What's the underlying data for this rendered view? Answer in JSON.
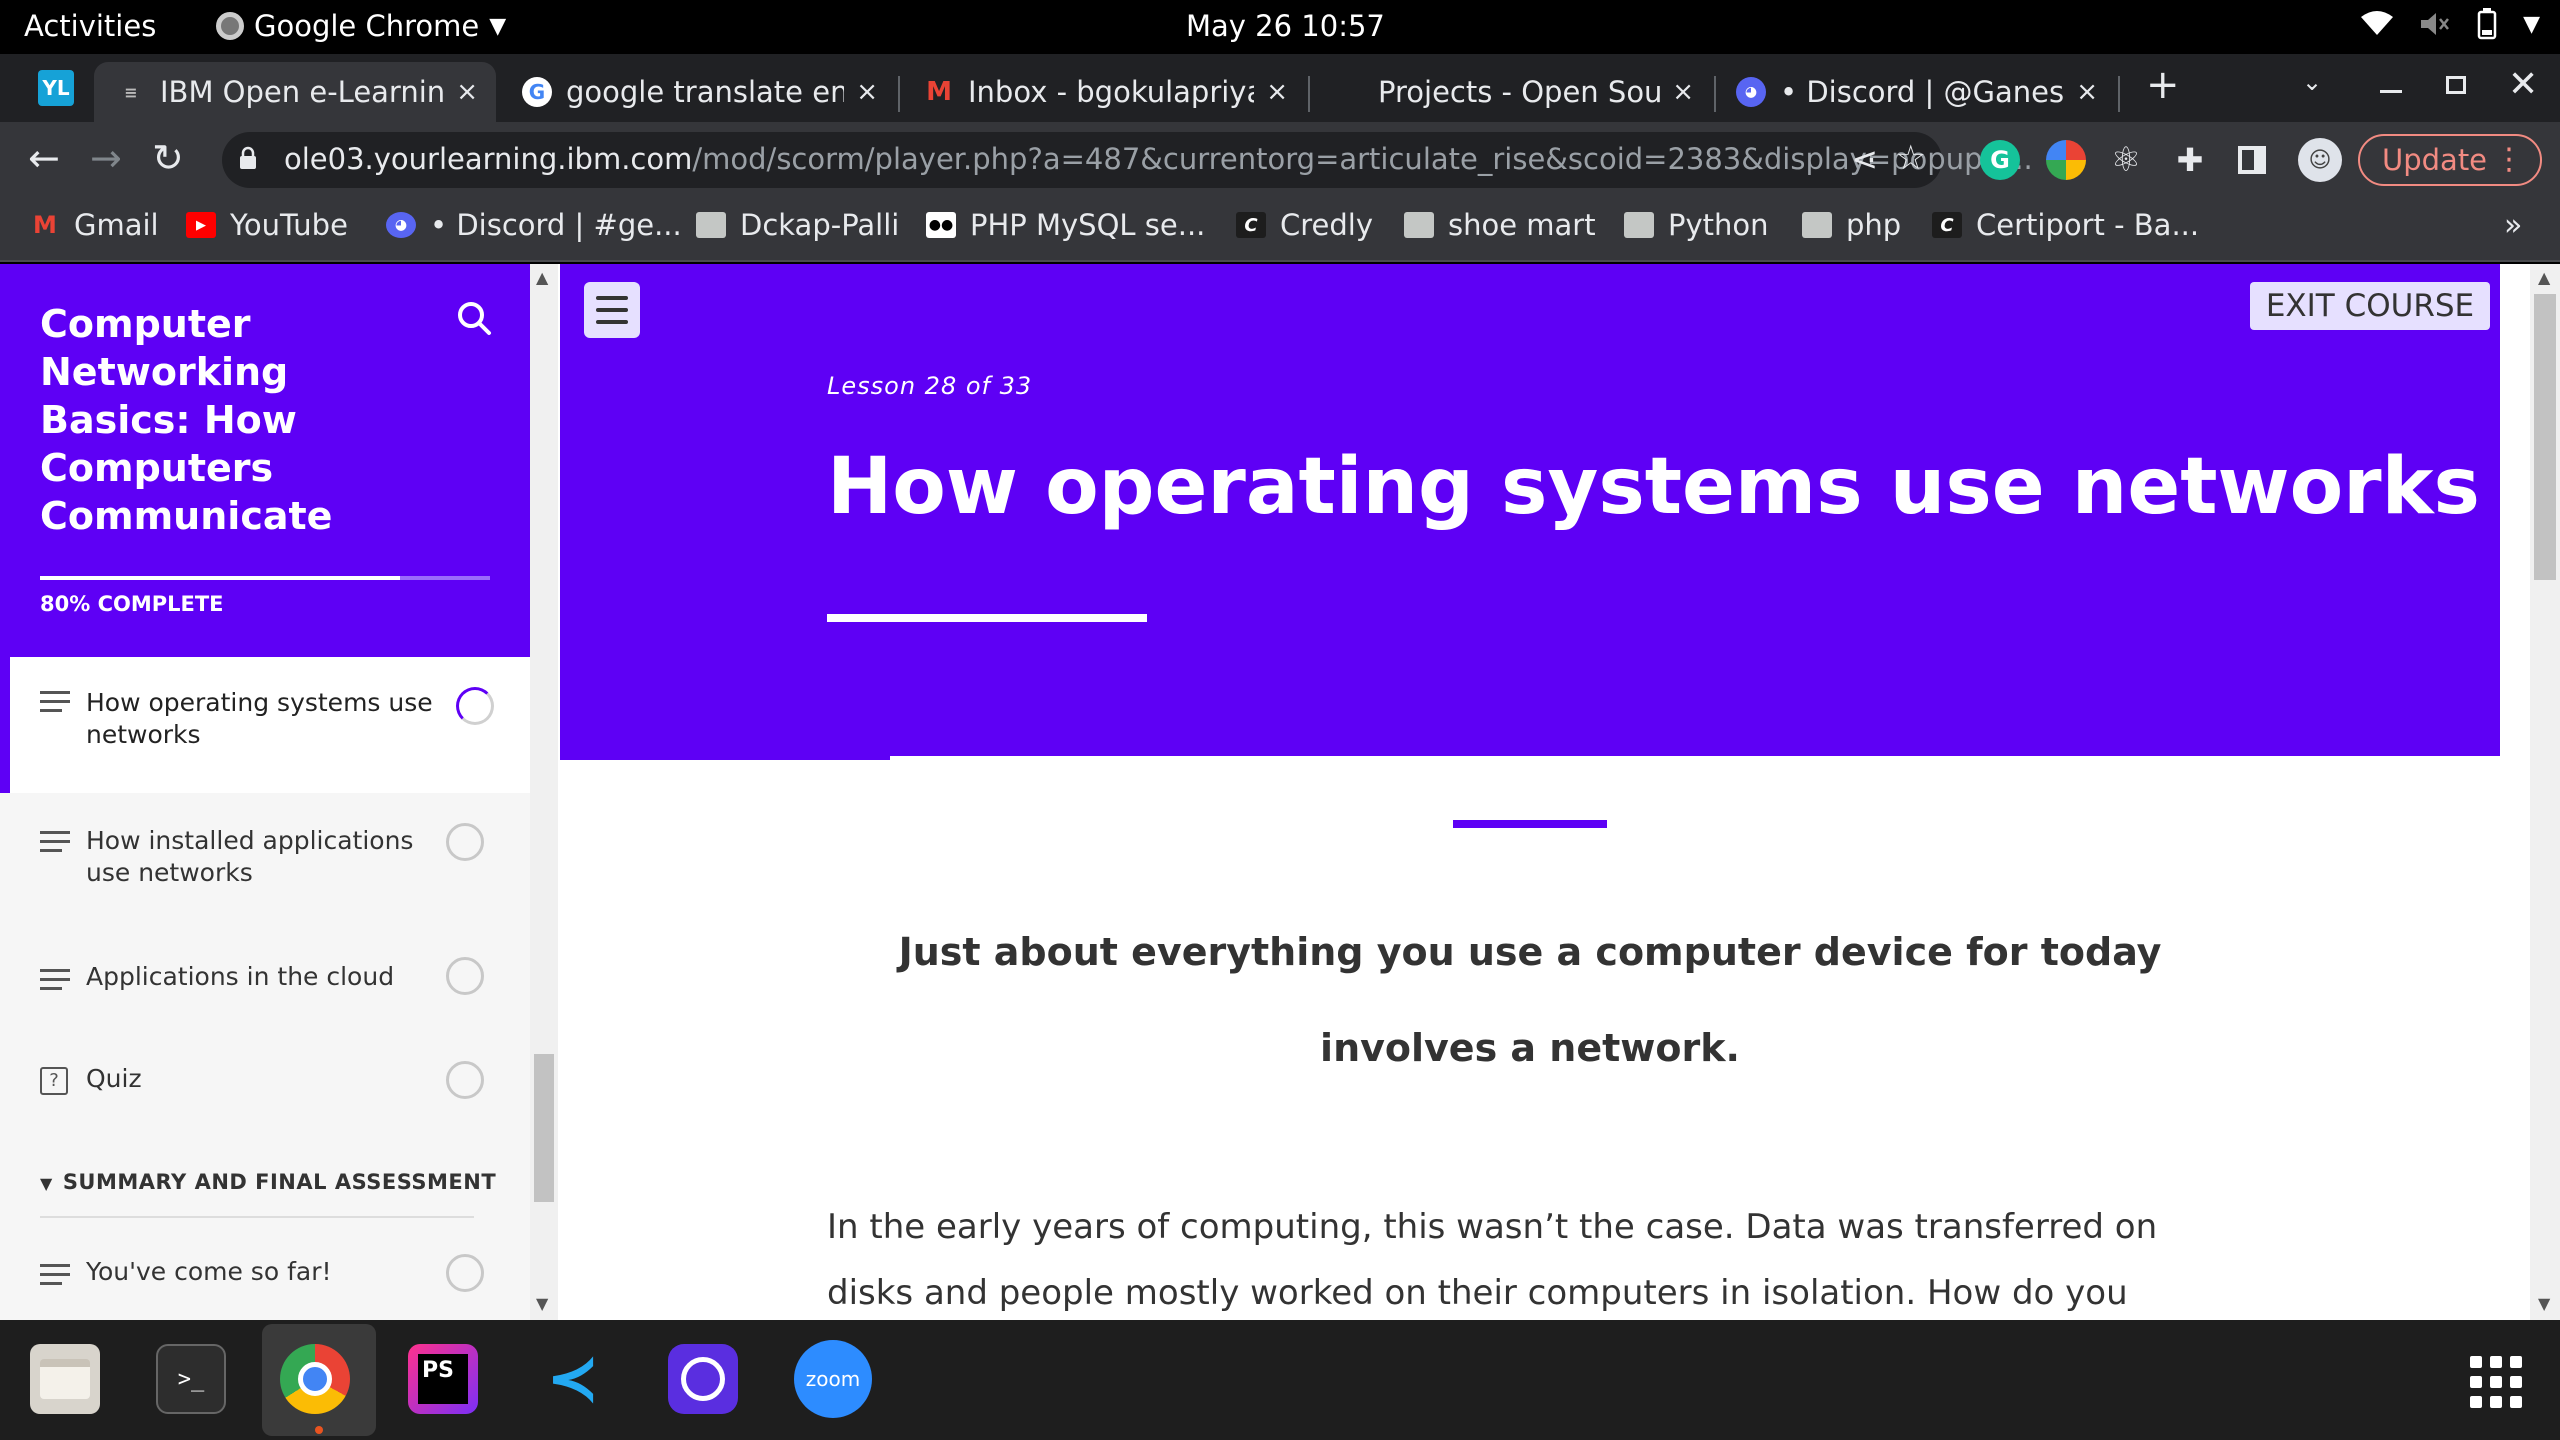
{
  "topbar": {
    "activities": "Activities",
    "app_name": "Google Chrome",
    "clock": "May 26  10:57"
  },
  "tabs": [
    {
      "title": "IBM Open e-Learning",
      "close": "×"
    },
    {
      "title": "google translate eng",
      "close": "×"
    },
    {
      "title": "Inbox - bgokulapriya",
      "close": "×"
    },
    {
      "title": "Projects - Open Sour",
      "close": "×"
    },
    {
      "title": "• Discord | @Ganesh",
      "close": "×"
    }
  ],
  "toolbar": {
    "url_host": "ole03.yourlearning.ibm.com",
    "url_path": "/mod/scorm/player.php?a=487&currentorg=articulate_rise&scoid=2383&display=popup&...",
    "update_label": "Update"
  },
  "bookmarks": [
    {
      "label": "Gmail"
    },
    {
      "label": "YouTube"
    },
    {
      "label": "• Discord | #ge..."
    },
    {
      "label": "Dckap-Palli"
    },
    {
      "label": "PHP MySQL se..."
    },
    {
      "label": "Credly"
    },
    {
      "label": "shoe mart"
    },
    {
      "label": "Python"
    },
    {
      "label": "php"
    },
    {
      "label": "Certiport - Ba..."
    }
  ],
  "sidebar": {
    "course_title": "Computer Networking Basics: How Computers Communicate",
    "progress_label": "80% COMPLETE",
    "progress_fraction": 0.8,
    "lessons": [
      {
        "label": "How operating systems use networks"
      },
      {
        "label": "How installed applications use networks"
      },
      {
        "label": "Applications in the cloud"
      },
      {
        "label": "Quiz"
      }
    ],
    "section_heading": "SUMMARY AND FINAL ASSESSMENT",
    "section_lessons": [
      {
        "label": "You've come so far!"
      }
    ]
  },
  "lesson": {
    "count": "Lesson 28 of 33",
    "title": "How operating systems use networks",
    "exit_label": "EXIT COURSE",
    "lead": "Just about everything you use a computer device for today involves a network.",
    "body": "In the early years of computing, this wasn’t the case. Data was transferred on disks and people mostly worked on their computers in isolation. How do you imagine an environment"
  },
  "colors": {
    "brand": "#5e00f5",
    "chrome_dark": "#202124",
    "chrome_toolbar": "#35363a",
    "update": "#f28b82"
  }
}
